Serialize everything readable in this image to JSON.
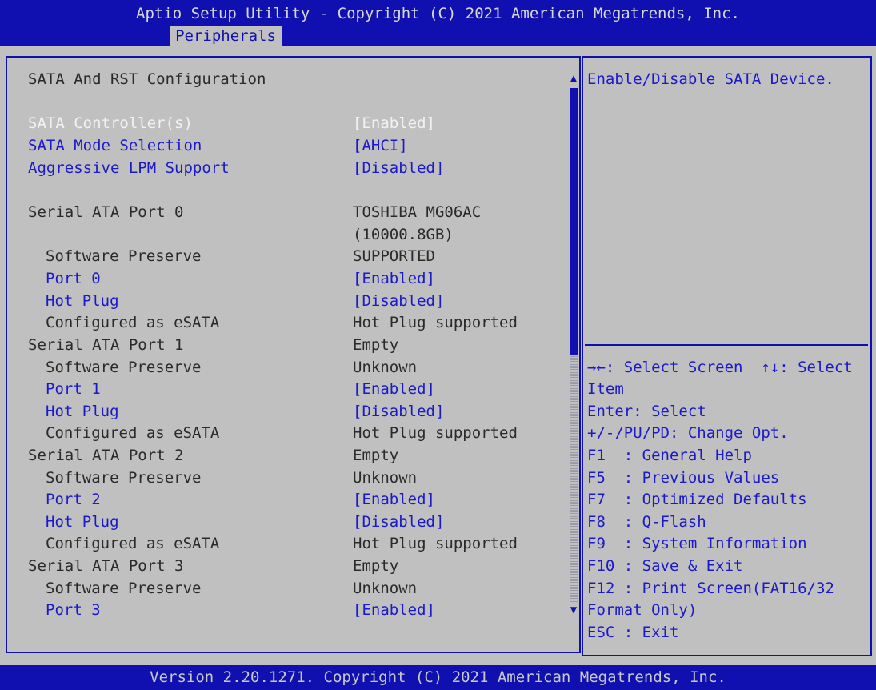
{
  "header": {
    "title": "Aptio Setup Utility - Copyright (C) 2021 American Megatrends, Inc.",
    "active_tab": "Peripherals"
  },
  "footer": {
    "version": "Version 2.20.1271. Copyright (C) 2021 American Megatrends, Inc."
  },
  "main": {
    "section_title": "SATA And RST Configuration",
    "rows": [
      {
        "label": "SATA Controller(s)",
        "value": "[Enabled]"
      },
      {
        "label": "SATA Mode Selection",
        "value": "[AHCI]"
      },
      {
        "label": "Aggressive LPM Support",
        "value": "[Disabled]"
      },
      {
        "label": "Serial ATA Port 0",
        "value": "TOSHIBA MG06AC"
      },
      {
        "label": "",
        "value": "(10000.8GB)"
      },
      {
        "label": "Software Preserve",
        "value": "SUPPORTED"
      },
      {
        "label": "Port 0",
        "value": "[Enabled]"
      },
      {
        "label": "Hot Plug",
        "value": "[Disabled]"
      },
      {
        "label": "Configured as eSATA",
        "value": "Hot Plug supported"
      },
      {
        "label": "Serial ATA Port 1",
        "value": "Empty"
      },
      {
        "label": "Software Preserve",
        "value": "Unknown"
      },
      {
        "label": "Port 1",
        "value": "[Enabled]"
      },
      {
        "label": "Hot Plug",
        "value": "[Disabled]"
      },
      {
        "label": "Configured as eSATA",
        "value": "Hot Plug supported"
      },
      {
        "label": "Serial ATA Port 2",
        "value": "Empty"
      },
      {
        "label": "Software Preserve",
        "value": "Unknown"
      },
      {
        "label": "Port 2",
        "value": "[Enabled]"
      },
      {
        "label": "Hot Plug",
        "value": "[Disabled]"
      },
      {
        "label": "Configured as eSATA",
        "value": "Hot Plug supported"
      },
      {
        "label": "Serial ATA Port 3",
        "value": "Empty"
      },
      {
        "label": "Software Preserve",
        "value": "Unknown"
      },
      {
        "label": "Port 3",
        "value": "[Enabled]"
      }
    ]
  },
  "help": {
    "description": "Enable/Disable SATA Device.",
    "keys": [
      "→←: Select Screen  ↑↓: Select",
      "Item",
      "Enter: Select",
      "+/-/PU/PD: Change Opt.",
      "F1  : General Help",
      "F5  : Previous Values",
      "F7  : Optimized Defaults",
      "F8  : Q-Flash",
      "F9  : System Information",
      "F10 : Save & Exit",
      "F12 : Print Screen(FAT16/32",
      "Format Only)",
      "ESC : Exit"
    ]
  },
  "scrollbar": {
    "up_glyph": "▲",
    "down_glyph": "▼"
  },
  "colors": {
    "bios_blue": "#1010b0",
    "background": "#c0c0c0",
    "selected_text": "#f2f2f2",
    "link_text": "#1a1ac8"
  }
}
